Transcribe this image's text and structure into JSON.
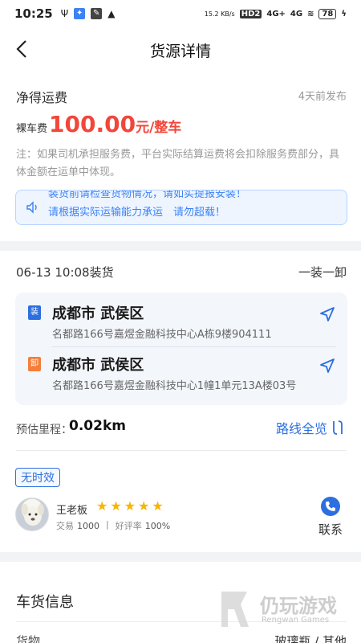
{
  "status_bar": {
    "time": "10:25",
    "network_speed": "15.2 KB/s",
    "hd": "HD2",
    "signal1": "4G+",
    "signal2": "4G",
    "battery": "78"
  },
  "nav": {
    "title": "货源详情"
  },
  "freight": {
    "label": "净得运费",
    "published": "4天前发布",
    "price_prefix": "裸车费",
    "price_value": "100.00",
    "price_unit": "元/整车",
    "note": "注：如果司机承担服务费，平台实际结算运费将会扣除服务费部分，具体金额在运单中体现。",
    "notice_prev": "装货前请检查货物情况，请如实提报安装！",
    "notice": "请根据实际运输能力承运　请勿超载！"
  },
  "shipment": {
    "load_time": "06-13 10:08装货",
    "load_type": "一装一卸",
    "load_tag": "装",
    "unload_tag": "卸",
    "load_city": "成都市 武侯区",
    "load_address": "名都路166号嘉煜金融科技中心A栋9楼904111",
    "unload_city": "成都市 武侯区",
    "unload_address": "名都路166号嘉煜金融科技中心1幢1单元13A楼03号",
    "distance_label": "预估里程：",
    "distance_value": "0.02km",
    "route_label": "路线全览",
    "time_badge": "无时效"
  },
  "owner": {
    "name": "王老板",
    "rating_stars": 5,
    "stars_text": "★★★★★",
    "trade_label": "交易",
    "trade_count": "1000",
    "praise_label": "好评率",
    "praise_rate": "100%",
    "contact_label": "联系"
  },
  "cargo": {
    "title": "车货信息",
    "row_label": "货物",
    "row_value": "玻璃瓶 / 其他"
  },
  "watermark": {
    "text": "仍玩游戏",
    "sub": "Rengwan Games"
  },
  "colors": {
    "accent": "#2c6fe0",
    "price": "#f2463a",
    "load_tag": "#2c6fe0",
    "unload_tag": "#f47f3b",
    "star": "#f7b500"
  }
}
